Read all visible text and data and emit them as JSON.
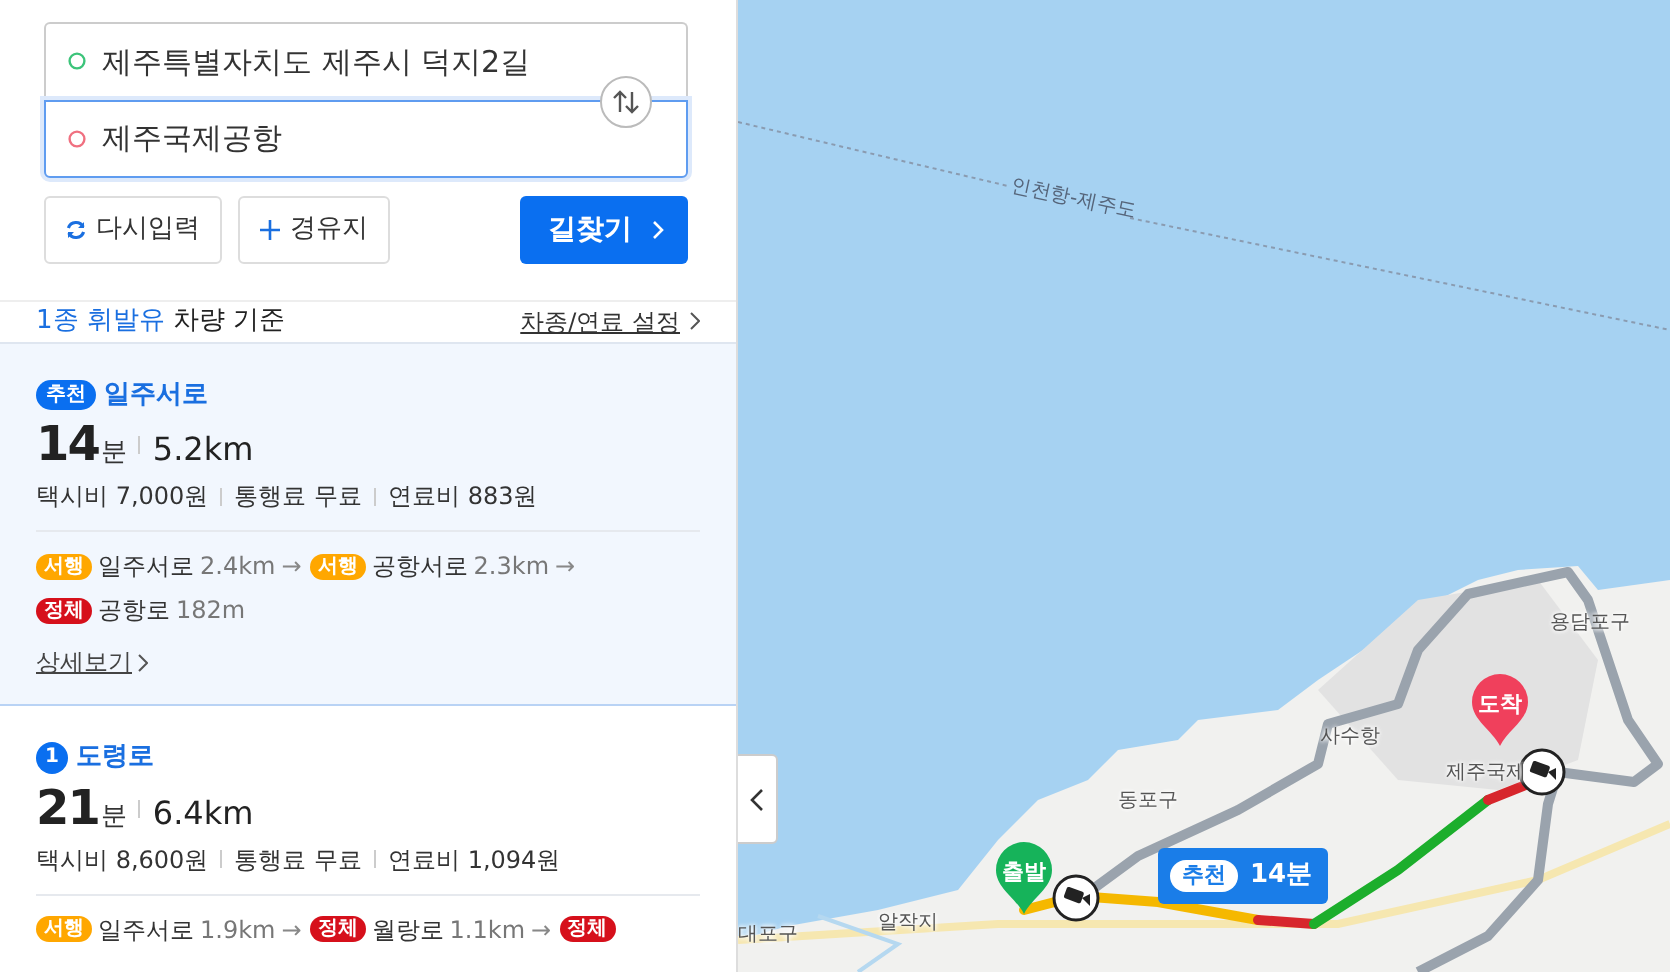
{
  "search": {
    "fields": [
      {
        "kind": "origin",
        "value": "제주특별자치도 제주시 덕지2길",
        "focused": false
      },
      {
        "kind": "destination",
        "value": "제주국제공항",
        "focused": true
      }
    ]
  },
  "buttons": [
    {
      "kind": "reset",
      "label": "다시입력"
    },
    {
      "kind": "waypoint",
      "label": "경유지"
    },
    {
      "kind": "search",
      "label": "길찾기"
    }
  ],
  "vehicle": {
    "type": "1종 휘발유",
    "suffix": "차량 기준",
    "settings": "차종/연료 설정"
  },
  "routes": [
    {
      "selected": true,
      "kind": "recommend",
      "badge": "추천",
      "name": "일주서로",
      "minutes": "14",
      "unit": "분",
      "distance": "5.2km",
      "costs": [
        "택시비 7,000원",
        "통행료 무료",
        "연료비 883원"
      ],
      "segments": [
        {
          "kind": "slow",
          "status": "서행",
          "road": "일주서로",
          "length": "2.4km",
          "arrow": "→"
        },
        {
          "kind": "slow",
          "status": "서행",
          "road": "공항서로",
          "length": "2.3km",
          "arrow": "→"
        },
        {
          "kind": "jam",
          "status": "정체",
          "road": "공항로",
          "length": "182m"
        }
      ],
      "detail": "상세보기"
    },
    {
      "selected": false,
      "kind": "number",
      "badge": "1",
      "name": "도령로",
      "minutes": "21",
      "unit": "분",
      "distance": "6.4km",
      "costs": [
        "택시비 8,600원",
        "통행료 무료",
        "연료비 1,094원"
      ],
      "segments": [
        {
          "kind": "slow",
          "status": "서행",
          "road": "일주서로",
          "length": "1.9km",
          "arrow": "→"
        },
        {
          "kind": "jam",
          "status": "정체",
          "road": "월랑로",
          "length": "1.1km",
          "arrow": "→"
        },
        {
          "kind": "jam",
          "status": "정체"
        }
      ]
    }
  ],
  "map": {
    "labels": [
      "인천항-제주도",
      "동포구",
      "사수항",
      "용담포구",
      "제주국제",
      "알작지",
      "대포구"
    ],
    "start": "출발",
    "end": "도착",
    "route_badge": "추천",
    "route_time": "14분"
  }
}
